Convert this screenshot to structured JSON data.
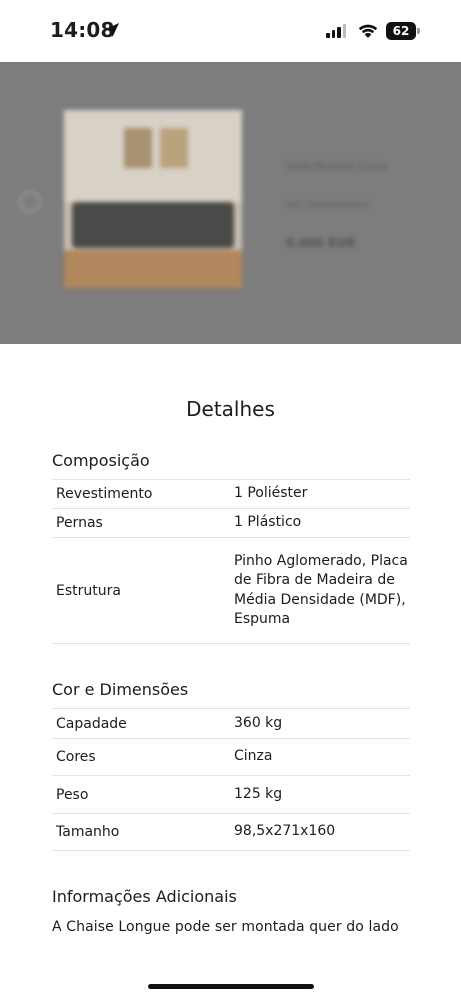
{
  "status_bar": {
    "time": "14:08",
    "battery": "62"
  },
  "product": {
    "title": "Sofá Modelo Cinza",
    "ref": "Ref. 00000000000",
    "price": "0.000 EUR"
  },
  "details": {
    "title": "Detalhes",
    "composition": {
      "title": "Composição",
      "rows": [
        {
          "label": "Revestimento",
          "value": "1 Poliéster"
        },
        {
          "label": "Pernas",
          "value": "1 Plástico"
        },
        {
          "label": "Estrutura",
          "value": "Pinho Aglomerado, Placa de Fibra de Madeira de Média Densidade (MDF), Espuma"
        }
      ]
    },
    "color_dimensions": {
      "title": "Cor e Dimensões",
      "rows": [
        {
          "label": "Capadade",
          "value": "360 kg"
        },
        {
          "label": "Cores",
          "value": "Cinza"
        },
        {
          "label": "Peso",
          "value": "125 kg"
        },
        {
          "label": "Tamanho",
          "value": "98,5x271x160"
        }
      ]
    },
    "additional": {
      "title": "Informações Adicionais",
      "text": "A Chaise Longue pode ser montada quer do lado"
    }
  },
  "icons": {
    "location": "location-arrow-icon",
    "wifi": "wifi-icon",
    "signal": "signal-icon",
    "battery": "battery-icon"
  }
}
